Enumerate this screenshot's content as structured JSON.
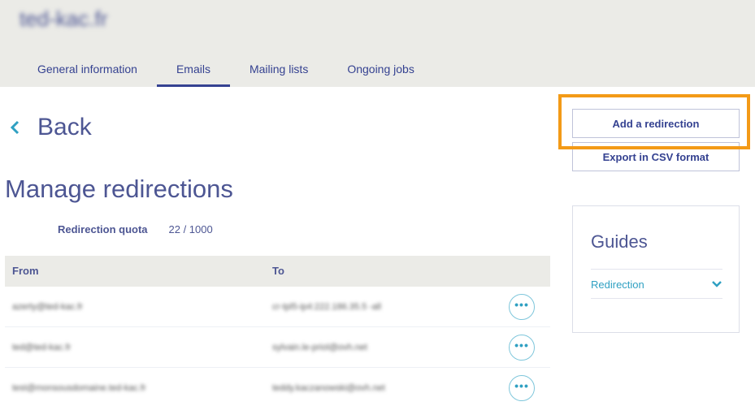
{
  "header": {
    "domain": "ted-kac.fr",
    "tabs": [
      {
        "label": "General information",
        "active": false
      },
      {
        "label": "Emails",
        "active": true
      },
      {
        "label": "Mailing lists",
        "active": false
      },
      {
        "label": "Ongoing jobs",
        "active": false
      }
    ]
  },
  "back": {
    "label": "Back",
    "icon": "chevron-left-icon"
  },
  "page": {
    "title": "Manage redirections"
  },
  "quota": {
    "label": "Redirection quota",
    "value": "22 / 1000"
  },
  "table": {
    "columns": {
      "from": "From",
      "to": "To"
    },
    "rows": [
      {
        "from": "azerty@ted-kac.fr",
        "to": "cr-tpl5-ip4:222.186.35.5 -all"
      },
      {
        "from": "ted@ted-kac.fr",
        "to": "sylvain.le-priol@ovh.net"
      },
      {
        "from": "test@monsousdomaine.ted-kac.fr",
        "to": "teddy.kaczanowski@ovh.net"
      }
    ],
    "row_action_glyph": "•••"
  },
  "actions": {
    "add_label": "Add a redirection",
    "export_label": "Export in CSV format"
  },
  "guides": {
    "title": "Guides",
    "items": [
      {
        "label": "Redirection",
        "icon": "chevron-down-icon"
      }
    ]
  },
  "colors": {
    "primary": "#354291",
    "accent": "#2fa0c2",
    "highlight": "#f39a17",
    "header_bg": "#ebebe7"
  }
}
